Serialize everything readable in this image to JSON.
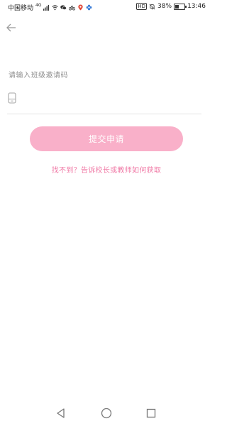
{
  "status_bar": {
    "carrier": "中国移动",
    "network": "4G",
    "hd_label": "HD",
    "battery_percent": "38%",
    "battery_level": 0.38,
    "time": "13:46",
    "icons": [
      "signal-icon",
      "wifi-icon",
      "wechat-icon",
      "bike-icon",
      "map-pin-icon",
      "flower-icon",
      "mute-icon",
      "battery-icon"
    ]
  },
  "header": {
    "back_icon": "arrow-left-icon"
  },
  "form": {
    "label": "请输入班级邀请码",
    "input_value": "",
    "input_placeholder": "",
    "input_icon": "phone-icon",
    "submit_label": "提交申请",
    "help_link": "找不到？告诉校长或教师如何获取"
  },
  "nav": {
    "back_icon": "triangle-back-icon",
    "home_icon": "circle-home-icon",
    "recent_icon": "square-recent-icon"
  },
  "colors": {
    "accent": "#f9b0c9",
    "link": "#f07aa6",
    "label": "#8f8f8f",
    "divider": "#e3e3e3"
  }
}
